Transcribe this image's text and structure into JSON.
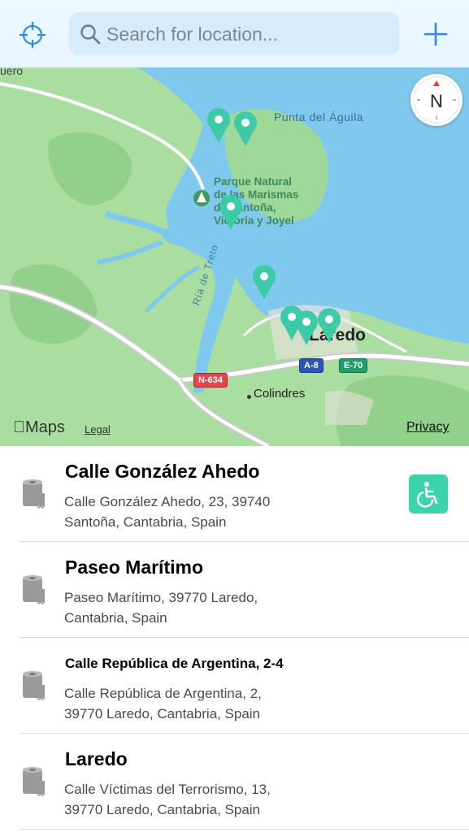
{
  "search": {
    "placeholder": "Search for location..."
  },
  "icons": {
    "locate": "crosshair-icon",
    "add": "plus-icon",
    "search": "magnifier-icon",
    "compass": "compass-icon",
    "toilet": "toilet-paper-icon",
    "wheelchair": "wheelchair-icon"
  },
  "colors": {
    "accent": "#2a8ce8",
    "pin": "#3dcaa6",
    "water": "#7fc9ee",
    "land": "#a9dea0",
    "wheelchair_badge": "#3cd3a8"
  },
  "map": {
    "compass_label": "N",
    "labels": {
      "top_left": "uero",
      "punta": "Punta del Águila",
      "park": [
        "Parque Natural",
        "de las Marismas",
        "de Santoña,",
        "Victoria y Joyel"
      ],
      "laredo": "Laredo",
      "colindres": "Colindres",
      "ria": "Ría de Treto"
    },
    "road_badges": {
      "n634": "N-634",
      "a8": "A-8",
      "e70": "E-70"
    },
    "attribution": {
      "maps": "Maps",
      "legal": "Legal",
      "privacy": "Privacy"
    }
  },
  "places": [
    {
      "title": "Calle González Ahedo",
      "address_line1": "Calle González Ahedo, 23, 39740",
      "address_line2": "Santoña, Cantabria, Spain",
      "accessible": true
    },
    {
      "title": "Paseo Marítimo",
      "address_line1": "Paseo Marítimo, 39770 Laredo,",
      "address_line2": "Cantabria, Spain",
      "accessible": false
    },
    {
      "title": "Calle República de Argentina, 2-4",
      "address_line1": "Calle República de Argentina, 2,",
      "address_line2": "39770 Laredo, Cantabria, Spain",
      "accessible": false
    },
    {
      "title": "Laredo",
      "address_line1": "Calle Víctimas del Terrorismo, 13,",
      "address_line2": "39770 Laredo, Cantabria, Spain",
      "accessible": false
    }
  ]
}
